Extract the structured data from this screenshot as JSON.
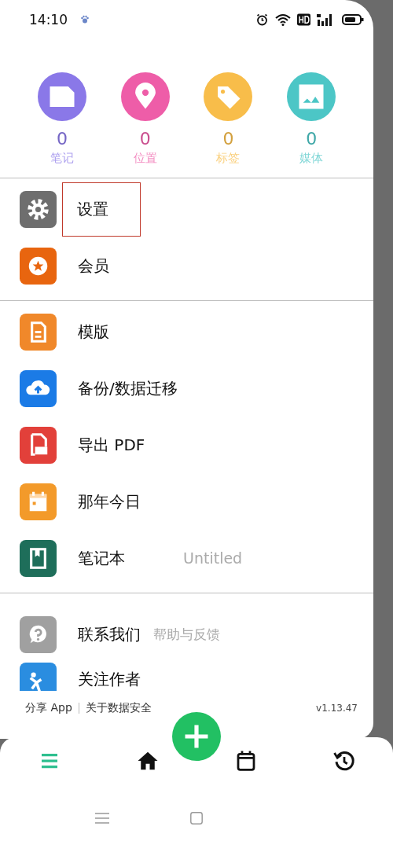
{
  "status_bar": {
    "time": "14:10"
  },
  "stats": [
    {
      "count": "0",
      "label": "笔记",
      "kind": "note",
      "color": "#8a78e8"
    },
    {
      "count": "0",
      "label": "位置",
      "kind": "pin",
      "color": "#ee5da8"
    },
    {
      "count": "0",
      "label": "标签",
      "kind": "tag",
      "color": "#f8bd4a"
    },
    {
      "count": "0",
      "label": "媒体",
      "kind": "image",
      "color": "#4cc6c6"
    }
  ],
  "menu_sections": [
    [
      {
        "label": "设置",
        "kind": "gear",
        "color": "#6e6e6e",
        "highlighted": true
      },
      {
        "label": "会员",
        "kind": "star",
        "color": "#e8650f",
        "highlighted": false
      }
    ],
    [
      {
        "label": "模版",
        "kind": "doc",
        "color": "#f0882a",
        "highlighted": false
      },
      {
        "label": "备份/数据迁移",
        "kind": "cloud",
        "color": "#1b7be6",
        "highlighted": false
      },
      {
        "label": "导出 PDF",
        "kind": "pdf",
        "color": "#e2403a",
        "highlighted": false
      },
      {
        "label": "那年今日",
        "kind": "calendar",
        "color": "#f39a2a",
        "highlighted": false
      },
      {
        "label": "笔记本",
        "kind": "book",
        "color": "#1e6e5a",
        "highlighted": false,
        "value": "Untitled"
      }
    ],
    [
      {
        "label": "联系我们",
        "kind": "help",
        "color": "#a0a0a0",
        "highlighted": false,
        "sub": "帮助与反馈"
      },
      {
        "label": "关注作者",
        "kind": "person",
        "color": "#2a8de0",
        "highlighted": false
      }
    ]
  ],
  "footer": {
    "links": [
      "分享 App",
      "关于数据安全"
    ],
    "version": "v1.13.47"
  },
  "bottom_nav": [
    {
      "kind": "menu",
      "selected": true
    },
    {
      "kind": "home",
      "selected": false
    },
    {
      "kind": "calendar",
      "selected": false
    },
    {
      "kind": "history",
      "selected": false
    }
  ]
}
